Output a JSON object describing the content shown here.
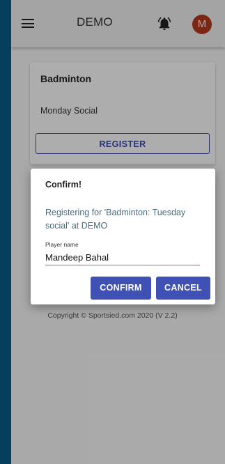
{
  "topbar": {
    "title": "DEMO",
    "avatar_initial": "M",
    "menu_icon": "hamburger-menu-icon",
    "notification_icon": "bell-icon"
  },
  "card": {
    "title": "Badminton",
    "subtitle": "Monday Social",
    "register_label": "REGISTER"
  },
  "footer": {
    "copyright": "Copyright © Sportsied.com 2020 (V 2.2)"
  },
  "dialog": {
    "title": "Confirm!",
    "message": "Registering for 'Badminton: Tuesday social' at DEMO",
    "field_label": "Player name",
    "field_value": "Mandeep Bahal",
    "confirm_label": "CONFIRM",
    "cancel_label": "CANCEL"
  },
  "colors": {
    "primary": "#3f51b5",
    "avatar": "#b83a1b",
    "sidebar_blue": "#0a5d8a"
  }
}
